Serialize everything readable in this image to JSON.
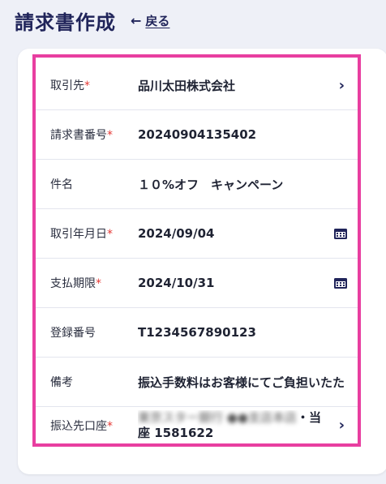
{
  "header": {
    "title": "請求書作成",
    "back_arrow": "←",
    "back_label": "戻る"
  },
  "form": {
    "required_mark": "*",
    "rows": [
      {
        "label": "取引先",
        "required": true,
        "value": "品川太田株式会社",
        "icon": "chevron-right-icon"
      },
      {
        "label": "請求書番号",
        "required": true,
        "value": "20240904135402"
      },
      {
        "label": "件名",
        "required": false,
        "value": "１０%オフ　キャンペーン"
      },
      {
        "label": "取引年月日",
        "required": true,
        "value": "2024/09/04",
        "icon": "calendar-icon"
      },
      {
        "label": "支払期限",
        "required": true,
        "value": "2024/10/31",
        "icon": "calendar-icon"
      },
      {
        "label": "登録番号",
        "required": false,
        "value": "T1234567890123"
      },
      {
        "label": "備考",
        "required": false,
        "value": "振込手数料はお客様にてご負担いたた"
      },
      {
        "label": "振込先口座",
        "required": true,
        "value_blurred": "東京スター銀行 ●●支店本店",
        "value_line1_end": "・当",
        "value_line2": "座 1581622",
        "icon": "chevron-right-icon"
      }
    ]
  },
  "colors": {
    "accent": "#20245a",
    "required": "#e53935",
    "highlight": "#e83ea0"
  }
}
